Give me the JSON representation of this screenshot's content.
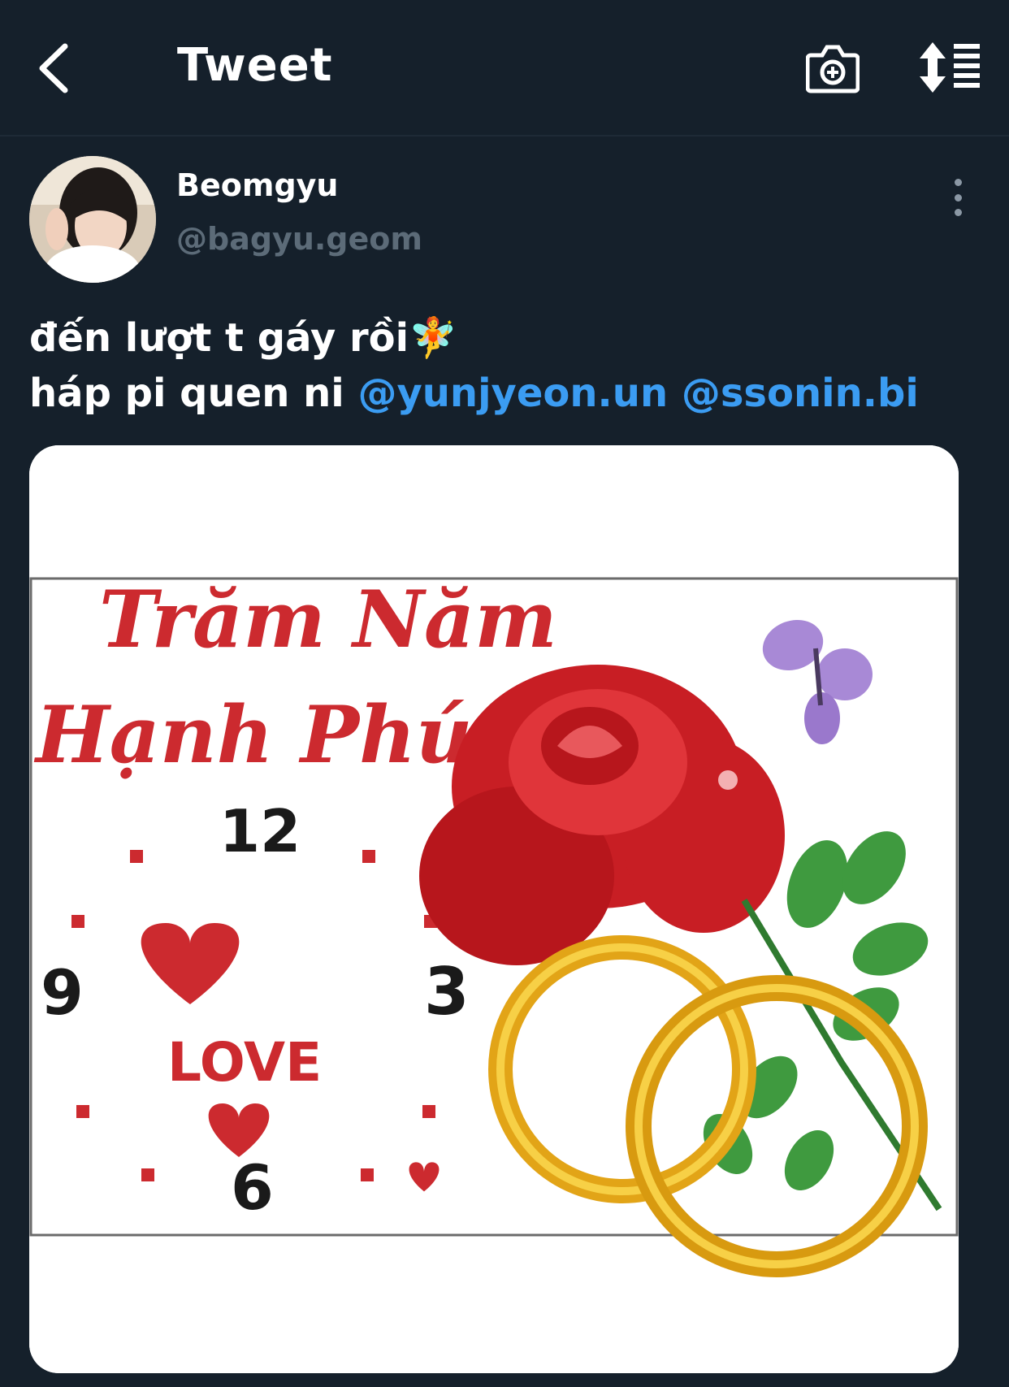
{
  "header": {
    "title": "Tweet"
  },
  "tweet": {
    "author_name": "Beomgyu",
    "author_handle": "@bagyu.geom",
    "line1_text": "đến lượt t gáy rồi",
    "line1_emoji": "🧚",
    "line2_text": "háp pi quen ni ",
    "mentions": [
      "@yunjyeon.un",
      "@ssonin.bi"
    ]
  },
  "media": {
    "title_line1": "Trăm Năm",
    "title_line2": "Hạnh Phúc",
    "clock_numbers": [
      "12",
      "3",
      "6",
      "9"
    ],
    "love_text": "LOVE"
  },
  "colors": {
    "background": "#15202b",
    "mention": "#3b9cf2",
    "handle": "#5c6b78",
    "image_red": "#cc2a2f"
  }
}
